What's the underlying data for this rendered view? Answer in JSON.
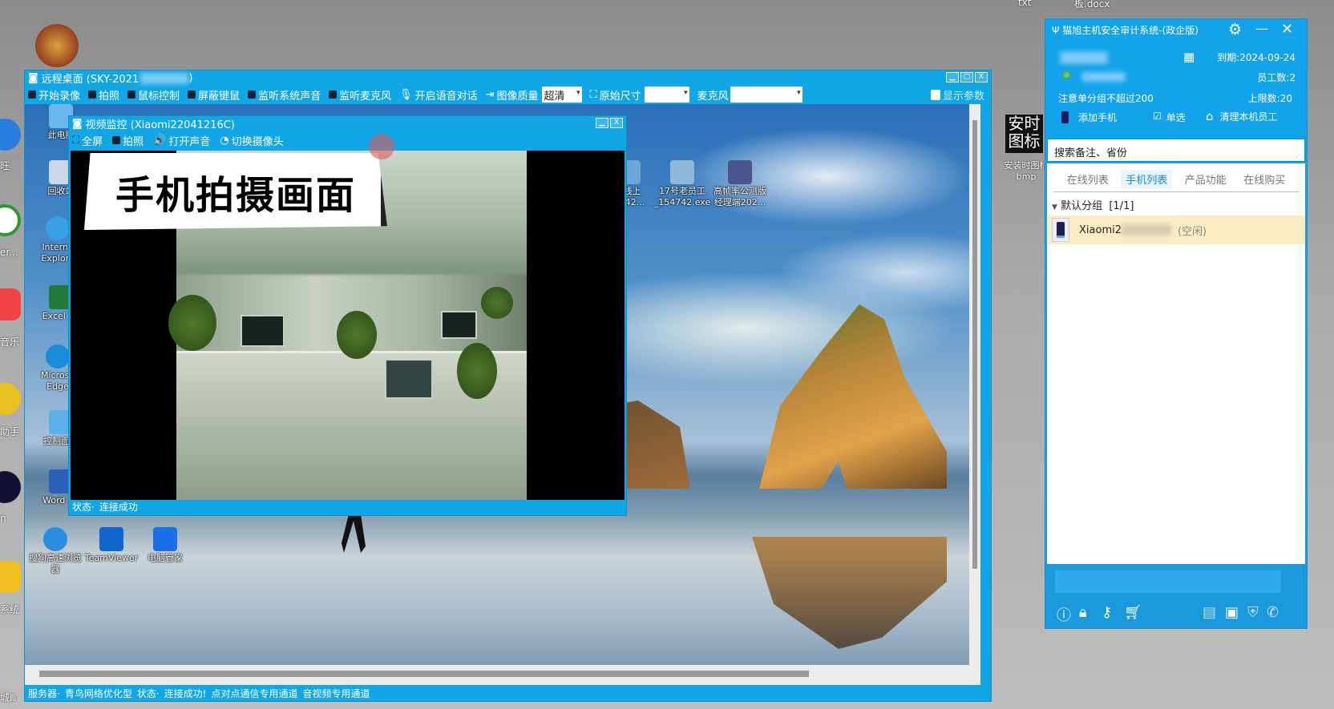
{
  "background_files": [
    "txt",
    "板.docx"
  ],
  "left_strip_labels": [
    "旺",
    "er...",
    "音乐",
    "助手",
    "n",
    "系统",
    "城Ⅲ"
  ],
  "remote_window": {
    "title": "远程桌面 (SKY-2021",
    "toolbar": {
      "record": "开始录像",
      "photo": "拍照",
      "mouse_control": "鼠标控制",
      "block_input": "屏蔽键鼠",
      "listen_system": "监听系统声音",
      "listen_mic": "监听麦克风",
      "voice_chat": "开启语音对话",
      "image_quality": "图像质量",
      "quality_value": "超清",
      "original_size": "原始尺寸",
      "size_value": "",
      "mic": "麦克风",
      "mic_value": "",
      "show_params": "显示参数"
    },
    "desktop_icons": [
      {
        "label": "此电脑"
      },
      {
        "label": "回收站"
      },
      {
        "label": "Interne Explore"
      },
      {
        "label": "Excel 20"
      },
      {
        "label": "Microso Edge"
      },
      {
        "label": "控制面板"
      },
      {
        "label": "Word 20"
      },
      {
        "label": "搜狗高速浏览器"
      },
      {
        "label": "TeamViewer"
      },
      {
        "label": "电脑管家"
      },
      {
        "label": "线上 742..."
      },
      {
        "label": "17号老员工 _154742.exe"
      },
      {
        "label": "高帧率公测版 经理端202..."
      }
    ],
    "status": {
      "server_label": "服务器·",
      "server": "青鸟网络优化型",
      "state_label": "状态·",
      "state": "连接成功!",
      "channel1": "点对点通信专用通道",
      "channel2": "音视频专用通道"
    }
  },
  "video_window": {
    "title": "视频监控 (Xiaomi22041216C)",
    "toolbar": {
      "fullscreen": "全屏",
      "photo": "拍照",
      "sound": "打开声音",
      "switch_camera": "切换摄像头"
    },
    "banner": "手机拍摄画面",
    "status_label": "状态·",
    "status": "连接成功"
  },
  "side_icon": {
    "text": "安时图标",
    "label": "安装时图标 bmp"
  },
  "panel": {
    "title": "猫旭主机安全审计系统-(政企版)",
    "expiry": "到期:2024-09-24",
    "employees": "员工数:2",
    "note": "注意单分组不超过200",
    "limit": "上限数:20",
    "actions": {
      "add_phone": "添加手机",
      "single_select": "单选",
      "clear_employees": "清理本机员工"
    },
    "search_placeholder": "搜索备注、省份",
    "tabs": [
      "在线列表",
      "手机列表",
      "产品功能",
      "在线购买"
    ],
    "active_tab": "手机列表",
    "group": "默认分组",
    "group_count": "[1/1]",
    "devices": [
      {
        "name": "Xiaomi2",
        "status": "(空闲)"
      }
    ],
    "accent": "#12a3ea"
  }
}
